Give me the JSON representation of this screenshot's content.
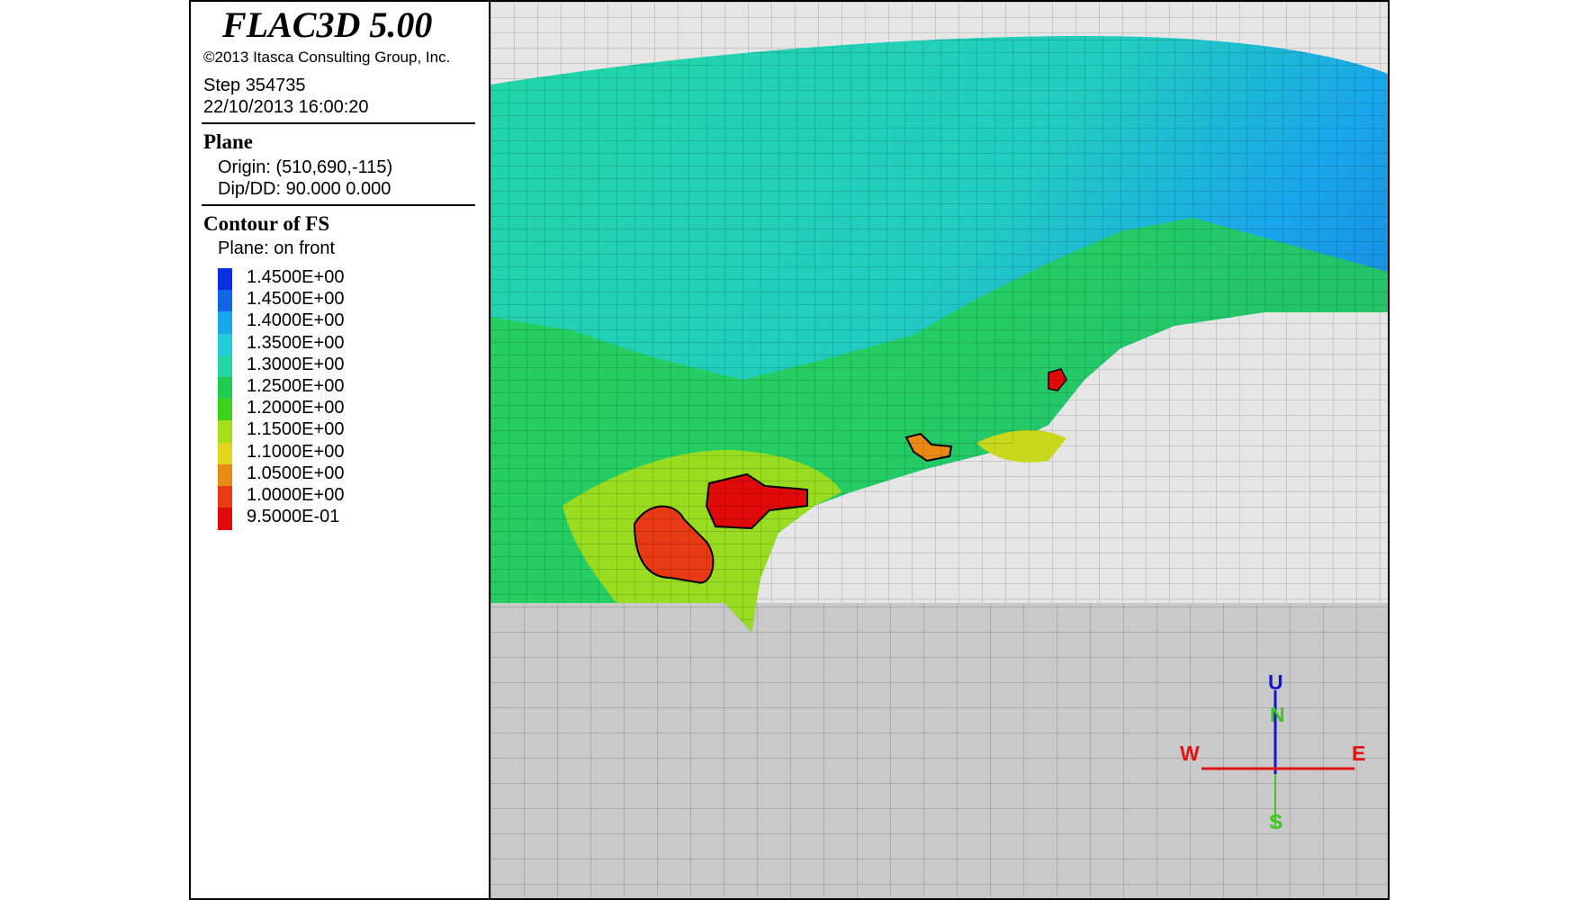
{
  "header": {
    "app_title": "FLAC3D 5.00",
    "copyright": "©2013 Itasca Consulting Group, Inc.",
    "step": "Step 354735",
    "timestamp": "22/10/2013 16:00:20"
  },
  "plane": {
    "title": "Plane",
    "origin": "Origin: (510,690,-115)",
    "dip": "Dip/DD: 90.000 0.000"
  },
  "contour": {
    "title": "Contour of FS",
    "plane_mode": "Plane: on front",
    "levels": [
      {
        "label": "1.4500E+00",
        "color": "#0a2fe0"
      },
      {
        "label": "1.4500E+00",
        "color": "#1166e6"
      },
      {
        "label": "1.4000E+00",
        "color": "#1aa6ea"
      },
      {
        "label": "1.3500E+00",
        "color": "#22ccd8"
      },
      {
        "label": "1.3000E+00",
        "color": "#22d6a6"
      },
      {
        "label": "1.2500E+00",
        "color": "#20cc4e"
      },
      {
        "label": "1.2000E+00",
        "color": "#3ed21c"
      },
      {
        "label": "1.1500E+00",
        "color": "#a6de1a"
      },
      {
        "label": "1.1000E+00",
        "color": "#e2d61c"
      },
      {
        "label": "1.0500E+00",
        "color": "#e88a14"
      },
      {
        "label": "1.0000E+00",
        "color": "#e83a14"
      },
      {
        "label": "9.5000E-01",
        "color": "#e00a0a"
      }
    ]
  },
  "axes": {
    "up": "U",
    "north": "N",
    "west": "W",
    "east": "E",
    "south": "S",
    "up_color": "#1414d2",
    "ns_color": "#3cc81e",
    "we_color": "#e01414"
  }
}
